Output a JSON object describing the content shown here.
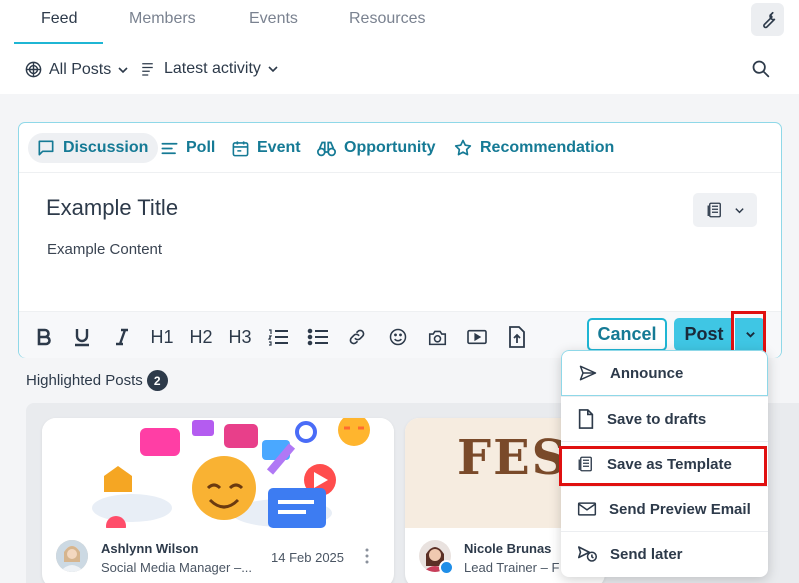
{
  "tabs": [
    {
      "label": "Feed",
      "active": true
    },
    {
      "label": "Members",
      "active": false
    },
    {
      "label": "Events",
      "active": false
    },
    {
      "label": "Resources",
      "active": false
    }
  ],
  "filters": {
    "posts_filter": "All Posts",
    "sort_filter": "Latest activity"
  },
  "composer": {
    "types": [
      {
        "label": "Discussion",
        "icon": "chat-bubble-icon",
        "active": true
      },
      {
        "label": "Poll",
        "icon": "poll-lines-icon",
        "active": false
      },
      {
        "label": "Event",
        "icon": "calendar-icon",
        "active": false
      },
      {
        "label": "Opportunity",
        "icon": "binoculars-icon",
        "active": false
      },
      {
        "label": "Recommendation",
        "icon": "star-icon",
        "active": false
      }
    ],
    "title": "Example Title",
    "content": "Example Content",
    "toolbar": {
      "h1": "H1",
      "h2": "H2",
      "h3": "H3"
    },
    "cancel_label": "Cancel",
    "post_label": "Post"
  },
  "highlighted": {
    "label": "Highlighted Posts",
    "count": "2",
    "posts": [
      {
        "author": "Ashlynn Wilson",
        "role": "Social Media Manager –...",
        "date": "14 Feb 2025"
      },
      {
        "author": "Nicole Brunas",
        "role": "Lead Trainer – F",
        "banner_text": "FEST"
      }
    ]
  },
  "post_menu": {
    "items": [
      {
        "label": "Announce",
        "icon": "send-icon"
      },
      {
        "label": "Save to drafts",
        "icon": "document-icon"
      },
      {
        "label": "Save as Template",
        "icon": "template-icon"
      },
      {
        "label": "Send Preview Email",
        "icon": "mail-icon"
      },
      {
        "label": "Send later",
        "icon": "scheduled-send-icon"
      }
    ]
  },
  "colors": {
    "accent": "#1fb6d4",
    "accent_text": "#157a95",
    "post_button": "#3fc6e4",
    "highlight_box": "#e01010"
  }
}
